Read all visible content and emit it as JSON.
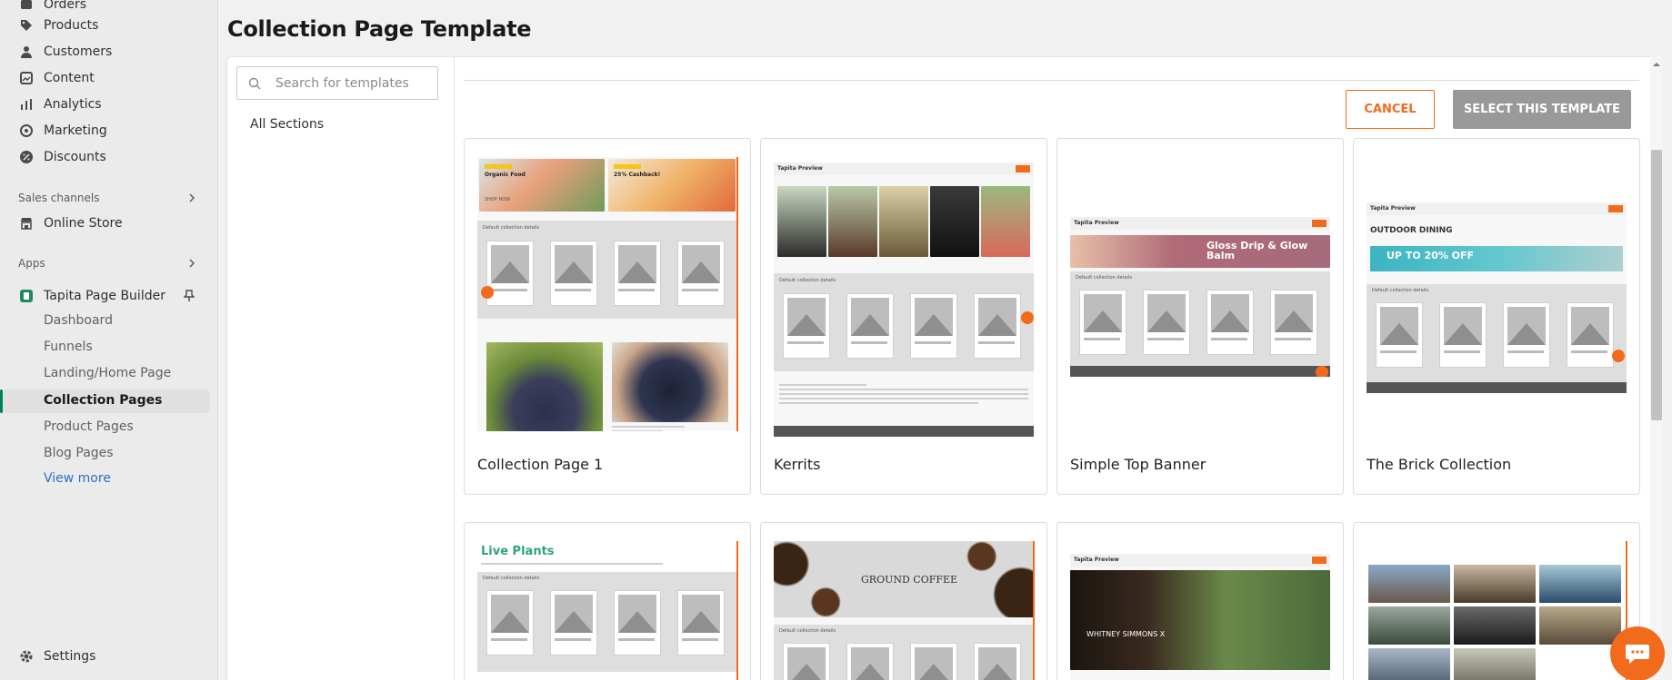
{
  "sidebar": {
    "nav": [
      {
        "label": "Orders",
        "icon": "orders-icon"
      },
      {
        "label": "Products",
        "icon": "tag-icon"
      },
      {
        "label": "Customers",
        "icon": "person-icon"
      },
      {
        "label": "Content",
        "icon": "content-icon"
      },
      {
        "label": "Analytics",
        "icon": "bar-chart-icon"
      },
      {
        "label": "Marketing",
        "icon": "target-icon"
      },
      {
        "label": "Discounts",
        "icon": "discount-icon"
      }
    ],
    "sales_channels_label": "Sales channels",
    "online_store": "Online Store",
    "apps_label": "Apps",
    "app_name": "Tapita Page Builder",
    "app_items": [
      "Dashboard",
      "Funnels",
      "Landing/Home Page",
      "Collection Pages",
      "Product Pages",
      "Blog Pages"
    ],
    "view_more": "View more",
    "settings": "Settings"
  },
  "page": {
    "title": "Collection Page Template"
  },
  "search": {
    "placeholder": "Search for templates"
  },
  "filters": {
    "all_sections": "All Sections"
  },
  "actions": {
    "cancel": "CANCEL",
    "select": "SELECT THIS TEMPLATE"
  },
  "templates": [
    {
      "name": "Collection Page 1"
    },
    {
      "name": "Kerrits"
    },
    {
      "name": "Simple Top Banner"
    },
    {
      "name": "The Brick Collection"
    }
  ],
  "preview_text": {
    "organic_food": "Organic Food",
    "cashback": "25% Cashback!",
    "shop_now": "SHOP NOW",
    "default_details": "Default collection details",
    "tapita_preview": "Tapita Preview",
    "gloss_drip": "Gloss Drip & Glow Balm",
    "outdoor_dining": "OUTDOOR DINING",
    "up_to_off": "UP TO 20% OFF",
    "live_plants": "Live Plants",
    "ground_coffee": "GROUND COFFEE",
    "whitney": "WHITNEY SIMMONS X"
  },
  "colors": {
    "accent": "#f26b1d",
    "active": "#008060",
    "link": "#2c6ecb"
  }
}
